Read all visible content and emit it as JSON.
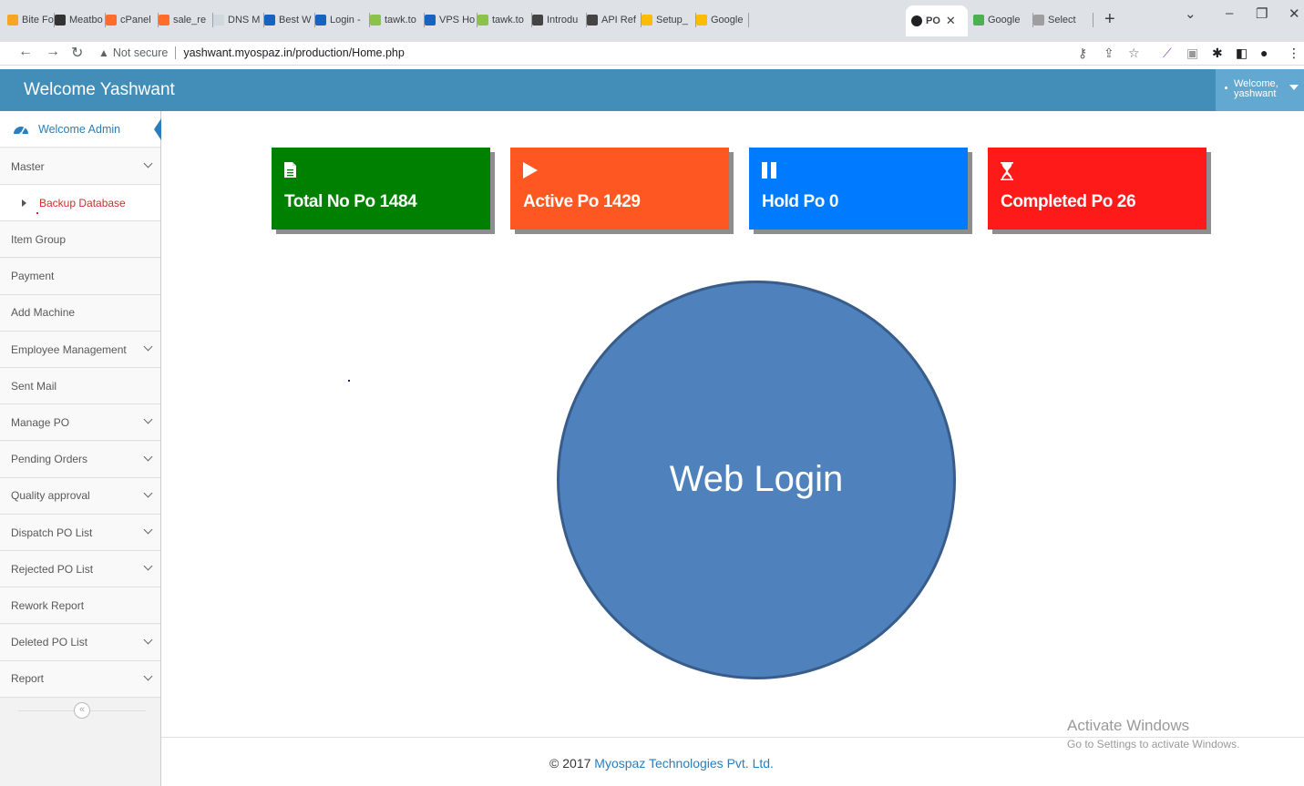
{
  "browser": {
    "tabs": [
      {
        "label": "Bite Fo",
        "color": "#f5a623"
      },
      {
        "label": "Meatbo",
        "color": "#333333"
      },
      {
        "label": "cPanel",
        "color": "#ff6c2c"
      },
      {
        "label": "sale_re",
        "color": "#ff6c2c"
      },
      {
        "label": "DNS M",
        "color": "#cfd8dc"
      },
      {
        "label": "Best W",
        "color": "#1565c0"
      },
      {
        "label": "Login -",
        "color": "#1565c0"
      },
      {
        "label": "tawk.to",
        "color": "#8bc34a"
      },
      {
        "label": "VPS Ho",
        "color": "#1565c0"
      },
      {
        "label": "tawk.to",
        "color": "#8bc34a"
      },
      {
        "label": "Introdu",
        "color": "#444444"
      },
      {
        "label": "API Ref",
        "color": "#444444"
      },
      {
        "label": "Setup_",
        "color": "#fbbc04"
      },
      {
        "label": "Google",
        "color": "#fbbc04"
      }
    ],
    "active_tab": {
      "label": "PO",
      "close": "✕"
    },
    "tabs_after": [
      {
        "label": "Google",
        "color": "#4caf50"
      },
      {
        "label": "Select",
        "color": "#9e9e9e"
      }
    ],
    "new_tab": "+",
    "address": {
      "warning": "Not secure",
      "url": "yashwant.myospaz.in/production/Home.php"
    }
  },
  "header": {
    "title": "Welcome Yashwant",
    "user_greeting": "Welcome,",
    "user_name": "yashwant"
  },
  "sidebar": {
    "active_item": "Welcome Admin",
    "items": [
      {
        "label": "Master",
        "has_children": true
      },
      {
        "label": "Backup Database",
        "sub": true
      },
      {
        "label": "Item Group",
        "has_children": false
      },
      {
        "label": "Payment",
        "has_children": false
      },
      {
        "label": "Add Machine",
        "has_children": false
      },
      {
        "label": "Employee Management",
        "has_children": true
      },
      {
        "label": "Sent Mail",
        "has_children": false
      },
      {
        "label": "Manage PO",
        "has_children": true
      },
      {
        "label": "Pending Orders",
        "has_children": true
      },
      {
        "label": "Quality approval",
        "has_children": true
      },
      {
        "label": "Dispatch PO List",
        "has_children": true
      },
      {
        "label": "Rejected PO List",
        "has_children": true
      },
      {
        "label": "Rework Report",
        "has_children": false
      },
      {
        "label": "Deleted PO List",
        "has_children": true
      },
      {
        "label": "Report",
        "has_children": true
      }
    ],
    "collapse_icon": "«"
  },
  "cards": [
    {
      "label": "Total No Po 1484",
      "icon": "document-icon",
      "color": "#008000"
    },
    {
      "label": "Active Po 1429",
      "icon": "play-icon",
      "color": "#ff5722"
    },
    {
      "label": "Hold Po 0",
      "icon": "pause-icon",
      "color": "#007bff"
    },
    {
      "label": "Completed Po 26",
      "icon": "hourglass-icon",
      "color": "#ff1a1a"
    }
  ],
  "main": {
    "circle_label": "Web Login"
  },
  "footer": {
    "copyright": "© 2017",
    "company": "Myospaz Technologies Pvt. Ltd."
  },
  "watermark": {
    "line1": "Activate Windows",
    "line2": "Go to Settings to activate Windows."
  }
}
